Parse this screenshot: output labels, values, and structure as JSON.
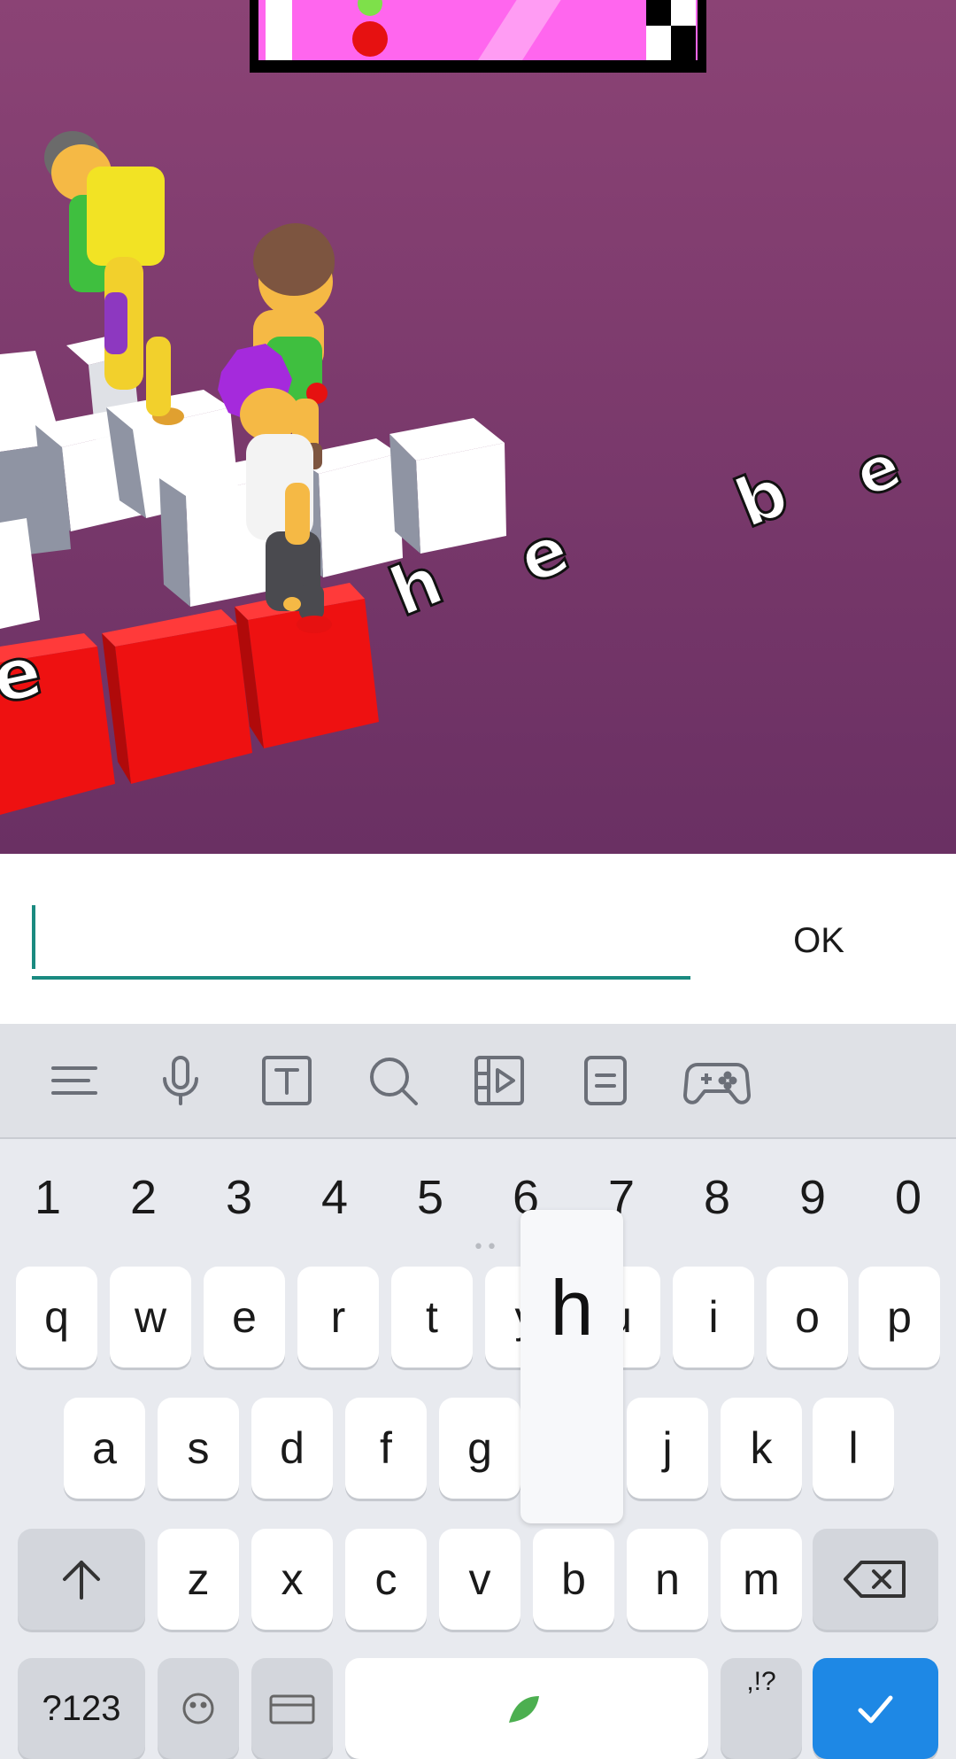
{
  "game": {
    "floating_letters": [
      "h",
      "e",
      "b",
      "e"
    ],
    "block_letter": "e",
    "colors": {
      "background_top": "#8b4375",
      "background_bottom": "#6a3063",
      "block_white": "#ffffff",
      "block_red": "#ee1111",
      "progress_bar": "#ff66ee"
    }
  },
  "input": {
    "value": "",
    "placeholder": "",
    "ok_label": "OK",
    "underline_color": "#1a8a80"
  },
  "keyboard_toolbar": {
    "icons": [
      "menu-icon",
      "microphone-icon",
      "text-format-icon",
      "search-icon",
      "media-icon",
      "clipboard-icon",
      "gamepad-icon"
    ]
  },
  "keyboard": {
    "number_row": [
      "1",
      "2",
      "3",
      "4",
      "5",
      "6",
      "7",
      "8",
      "9",
      "0"
    ],
    "row1": [
      "q",
      "w",
      "e",
      "r",
      "t",
      "y",
      "u",
      "i",
      "o",
      "p"
    ],
    "row2": [
      "a",
      "s",
      "d",
      "f",
      "g",
      "h",
      "j",
      "k",
      "l"
    ],
    "row3": [
      "z",
      "x",
      "c",
      "v",
      "b",
      "n",
      "m"
    ],
    "pressed_key": "h",
    "bottom_row": {
      "symbols_label": "?123",
      "punctuation_hint": ",!?"
    }
  }
}
